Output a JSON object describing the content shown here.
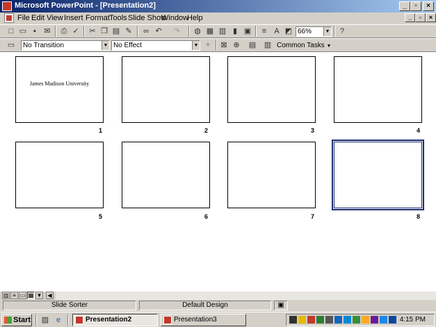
{
  "window": {
    "title": "Microsoft PowerPoint - [Presentation2]"
  },
  "caption_buttons": {
    "minimize": "_",
    "maximize": "▫",
    "close": "×"
  },
  "menu": [
    "File",
    "Edit",
    "View",
    "Insert",
    "Format",
    "Tools",
    "Slide Show",
    "Window",
    "Help"
  ],
  "toolbar": {
    "zoom": "66%"
  },
  "sorter_toolbar": {
    "transition": "No Transition",
    "effect": "No Effect",
    "common_tasks": "Common Tasks"
  },
  "slides": [
    {
      "number": "1",
      "text": "James Madison University"
    },
    {
      "number": "2",
      "text": ""
    },
    {
      "number": "3",
      "text": ""
    },
    {
      "number": "4",
      "text": ""
    },
    {
      "number": "5",
      "text": ""
    },
    {
      "number": "6",
      "text": ""
    },
    {
      "number": "7",
      "text": ""
    },
    {
      "number": "8",
      "text": "",
      "selected": true
    }
  ],
  "status": {
    "view": "Slide Sorter",
    "design": "Default Design"
  },
  "taskbar": {
    "start": "Start",
    "tasks": [
      {
        "label": "Presentation2",
        "active": true
      },
      {
        "label": "Presentation3",
        "active": false
      }
    ],
    "clock": "4:15 PM"
  }
}
